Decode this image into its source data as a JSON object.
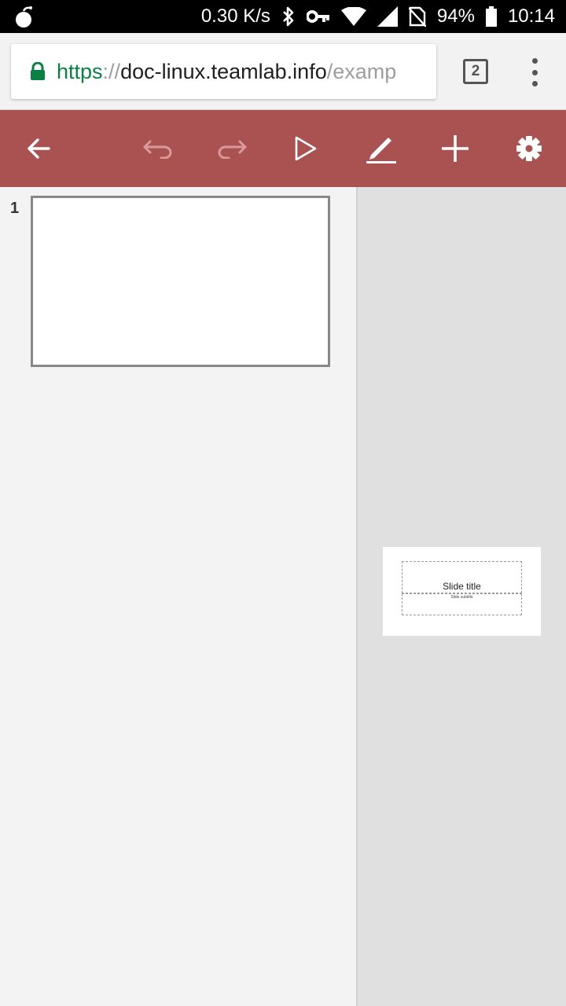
{
  "status_bar": {
    "network_speed": "0.30 K/s",
    "battery": "94%",
    "time": "10:14"
  },
  "browser": {
    "url_scheme": "https",
    "url_separator": "://",
    "url_host": "doc-linux.teamlab.info",
    "url_path": "/examp",
    "tab_count": "2"
  },
  "toolbar": {
    "background_color": "#aa5252",
    "buttons": [
      "back-arrow-icon",
      "undo-icon",
      "redo-icon",
      "play-icon",
      "pencil-icon",
      "plus-icon",
      "gear-icon"
    ]
  },
  "slides_panel": {
    "slides": [
      {
        "number": "1"
      }
    ]
  },
  "editor": {
    "placeholder_title": "Slide title",
    "placeholder_subtitle": "Slide subtitle"
  }
}
